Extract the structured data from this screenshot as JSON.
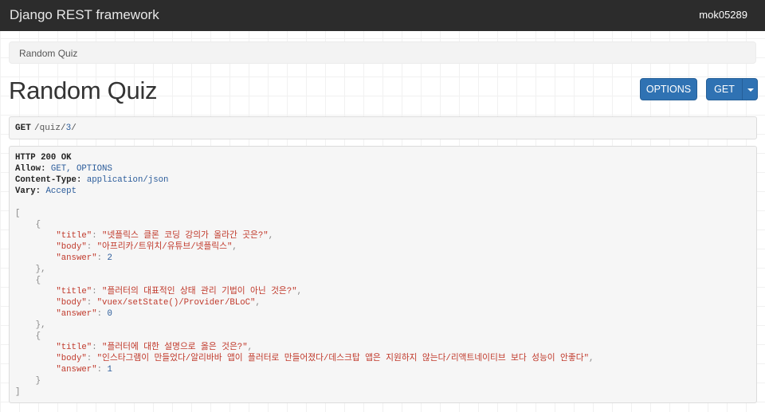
{
  "navbar": {
    "brand": "Django REST framework",
    "user": "mok05289"
  },
  "breadcrumb": {
    "item": "Random Quiz"
  },
  "page_title": "Random Quiz",
  "buttons": {
    "options": "OPTIONS",
    "get": "GET"
  },
  "request": {
    "method": "GET",
    "path_prefix": "/quiz/",
    "path_id": "3",
    "path_suffix": "/"
  },
  "response": {
    "status": "HTTP 200 OK",
    "headers": [
      {
        "name": "Allow:",
        "value": "GET, OPTIONS"
      },
      {
        "name": "Content-Type:",
        "value": "application/json"
      },
      {
        "name": "Vary:",
        "value": "Accept"
      }
    ],
    "items": [
      {
        "title": "넷플릭스 클론 코딩 강의가 올라간 곳은?",
        "body": "아프리카/트위치/유튜브/넷플릭스",
        "answer": "2"
      },
      {
        "title": "플러터의 대표적인 상태 관리 기법이 아닌 것은?",
        "body": "vuex/setState()/Provider/BLoC",
        "answer": "0"
      },
      {
        "title": "플러터에 대한 설명으로 옳은 것은?",
        "body": "인스타그램이 만들었다/알리바바 앱이 플러터로 만들어졌다/데스크탑 앱은 지원하지 않는다/리액트네이티브 보다 성능이 안좋다",
        "answer": "1"
      }
    ]
  }
}
